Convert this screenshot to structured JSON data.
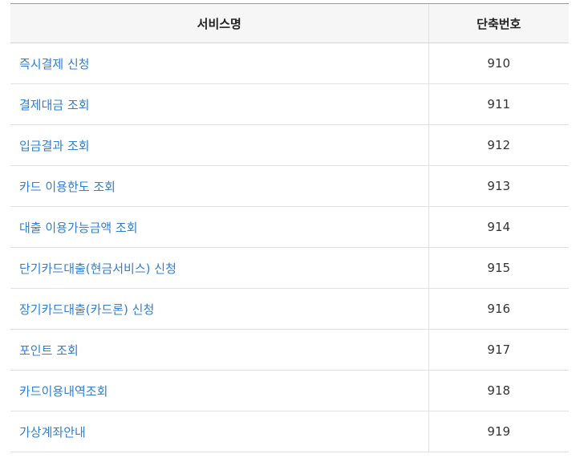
{
  "table": {
    "headers": {
      "service_name": "서비스명",
      "short_code": "단축번호"
    },
    "rows": [
      {
        "name": "즉시결제 신청",
        "code": "910"
      },
      {
        "name": "결제대금 조회",
        "code": "911"
      },
      {
        "name": "입금결과 조회",
        "code": "912"
      },
      {
        "name": "카드 이용한도 조회",
        "code": "913"
      },
      {
        "name": "대출 이용가능금액 조회",
        "code": "914"
      },
      {
        "name": "단기카드대출(현금서비스) 신청",
        "code": "915"
      },
      {
        "name": "장기카드대출(카드론) 신청",
        "code": "916"
      },
      {
        "name": "포인트 조회",
        "code": "917"
      },
      {
        "name": "카드이용내역조회",
        "code": "918"
      },
      {
        "name": "가상계좌안내",
        "code": "919"
      }
    ]
  },
  "colors": {
    "link": "#2f7fd1",
    "header_bg": "#f6f6f6",
    "border": "#e2e2e2"
  }
}
